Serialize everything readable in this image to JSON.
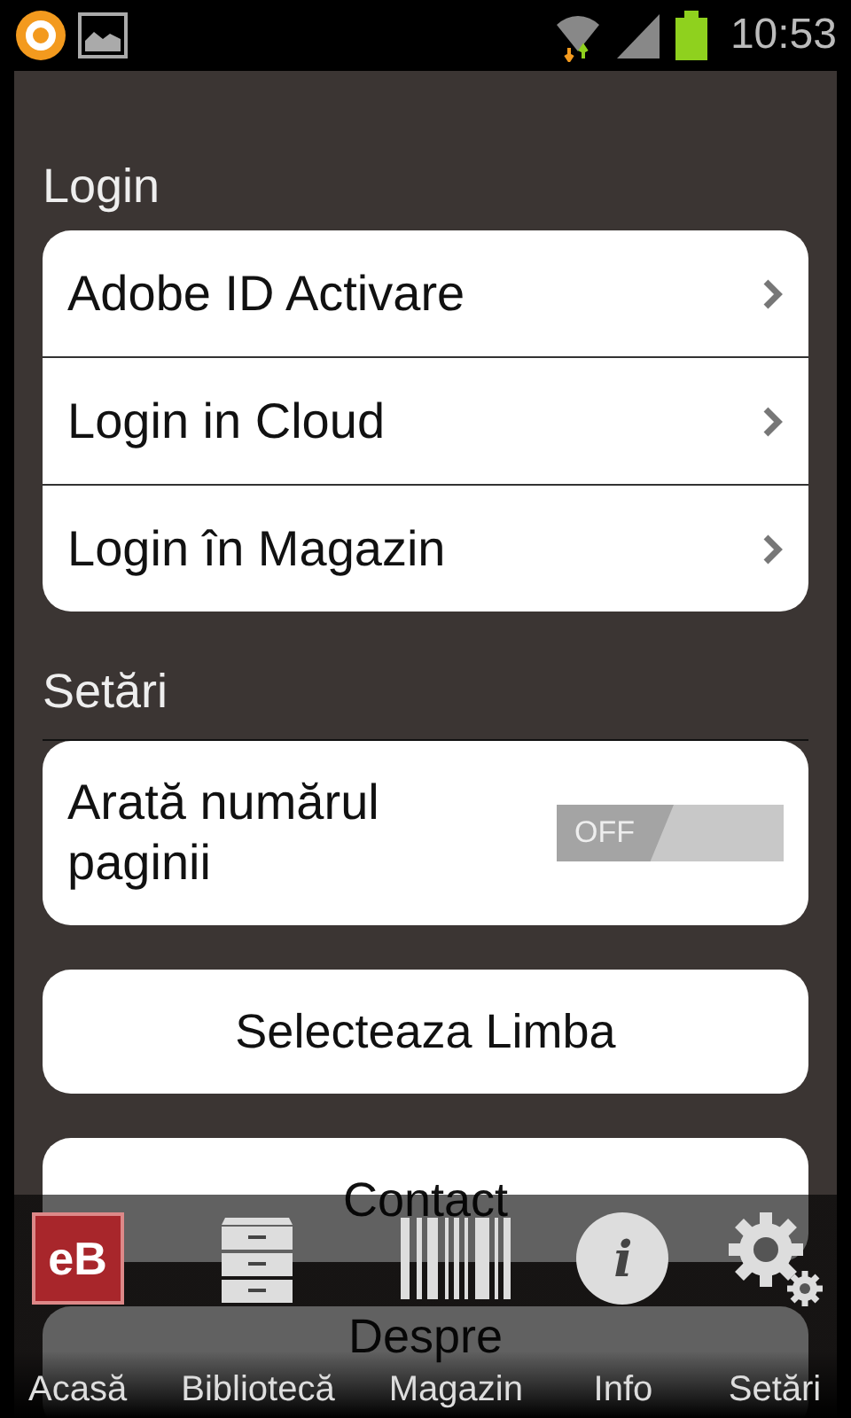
{
  "status_bar": {
    "time": "10:53"
  },
  "sections": [
    {
      "title": "Login",
      "items": [
        {
          "kind": "link",
          "label": "Adobe ID Activare"
        },
        {
          "kind": "link",
          "label": "Login in Cloud"
        },
        {
          "kind": "link",
          "label": "Login în Magazin"
        }
      ]
    },
    {
      "title": "Setări",
      "items": [
        {
          "kind": "toggle",
          "label": "Arată numărul paginii",
          "on": false,
          "toggle_text": "OFF"
        }
      ]
    }
  ],
  "buttons": [
    "Selecteaza Limba",
    "Contact",
    "Despre"
  ],
  "nav": [
    {
      "kind": "home",
      "label": "Acasă",
      "badge": "eB"
    },
    {
      "kind": "library",
      "label": "Bibliotecă"
    },
    {
      "kind": "store",
      "label": "Magazin"
    },
    {
      "kind": "info",
      "label": "Info",
      "glyph": "i"
    },
    {
      "kind": "settings",
      "label": "Setări"
    }
  ]
}
